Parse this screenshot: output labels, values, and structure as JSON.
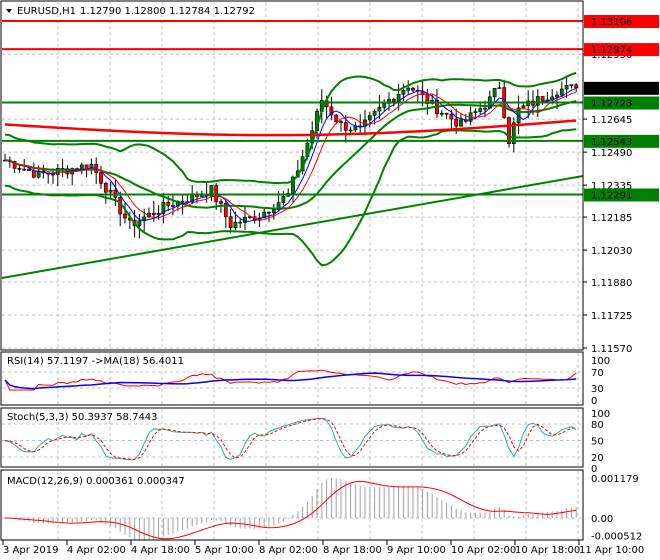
{
  "header": {
    "symbol": "EURUSD,H1",
    "ohlc": "1.12790 1.12800 1.12784 1.12792"
  },
  "price_axis": [
    "1.12950",
    "1.12645",
    "1.12490",
    "1.12335",
    "1.12185",
    "1.12030",
    "1.11880",
    "1.11725",
    "1.11570"
  ],
  "price_range": [
    1.1157,
    1.13175
  ],
  "levels": [
    {
      "label": "1.13106",
      "value": 1.13106,
      "color": "#ff0000"
    },
    {
      "label": "1.12974",
      "value": 1.12974,
      "color": "#ff0000"
    },
    {
      "label": "1.12723",
      "value": 1.12723,
      "color": "#008000"
    },
    {
      "label": "1.12543",
      "value": 1.12543,
      "color": "#008000"
    },
    {
      "label": "1.12291",
      "value": 1.12291,
      "color": "#008000"
    }
  ],
  "current_price": {
    "label": "1.12792",
    "value": 1.12792
  },
  "close_keypoints": [
    [
      0,
      1.12453
    ],
    [
      7,
      1.12383
    ],
    [
      18,
      1.1243
    ],
    [
      22,
      1.12289
    ],
    [
      26,
      1.12148
    ],
    [
      34,
      1.12242
    ],
    [
      43,
      1.12312
    ],
    [
      47,
      1.12148
    ],
    [
      53,
      1.12195
    ],
    [
      59,
      1.12289
    ],
    [
      64,
      1.12594
    ],
    [
      66,
      1.12735
    ],
    [
      70,
      1.12617
    ],
    [
      74,
      1.12594
    ],
    [
      80,
      1.12735
    ],
    [
      84,
      1.12805
    ],
    [
      89,
      1.12711
    ],
    [
      95,
      1.12617
    ],
    [
      101,
      1.12735
    ],
    [
      103,
      1.12805
    ],
    [
      105,
      1.12547
    ],
    [
      107,
      1.12688
    ],
    [
      115,
      1.12782
    ],
    [
      119,
      1.12792
    ]
  ],
  "rsi": {
    "label": "RSI(14) 57.1197  ->MA(18) 56.4011",
    "axis": [
      "100",
      "70",
      "30",
      "0"
    ]
  },
  "stoch": {
    "label": "Stoch(5,3,3) 50.3937 58.7443",
    "axis": [
      "100",
      "80",
      "50",
      "20",
      "0"
    ]
  },
  "macd": {
    "label": "MACD(12,26,9) 0.000361 0.000347",
    "axis": [
      "0.001179",
      "0.00",
      "-0.000512"
    ]
  },
  "time_axis": [
    "3 Apr 2019",
    "4 Apr 02:00",
    "4 Apr 18:00",
    "5 Apr 10:00",
    "8 Apr 02:00",
    "8 Apr 18:00",
    "9 Apr 10:00",
    "10 Apr 02:00",
    "10 Apr 18:00",
    "11 Apr 10:00"
  ],
  "colors": {
    "bull": "#008000",
    "bear": "#ff0000",
    "band": "#008000",
    "ma": "#ff0000",
    "stoch_main": "#20b2aa",
    "rsi_ma": "#0000ff"
  }
}
